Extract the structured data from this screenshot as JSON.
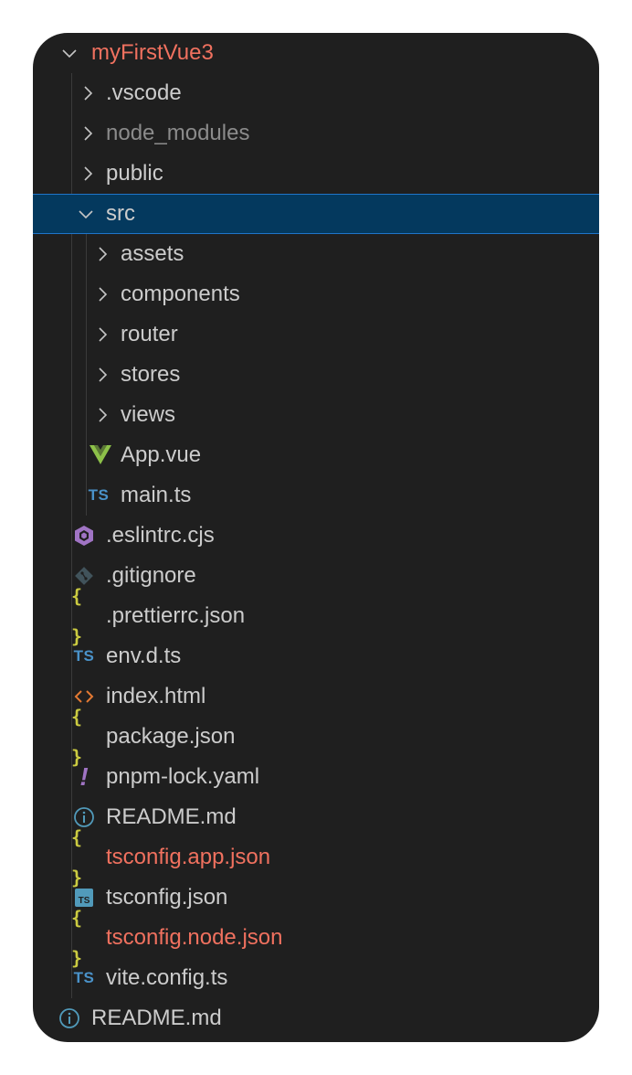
{
  "explorer": {
    "root": {
      "label": "myFirstVue3",
      "expanded": true
    },
    "items": [
      {
        "label": ".vscode",
        "kind": "folder",
        "expanded": false,
        "depth": 1
      },
      {
        "label": "node_modules",
        "kind": "folder",
        "expanded": false,
        "depth": 1,
        "ignored": true
      },
      {
        "label": "public",
        "kind": "folder",
        "expanded": false,
        "depth": 1
      },
      {
        "label": "src",
        "kind": "folder",
        "expanded": true,
        "depth": 1,
        "selected": true
      },
      {
        "label": "assets",
        "kind": "folder",
        "expanded": false,
        "depth": 2
      },
      {
        "label": "components",
        "kind": "folder",
        "expanded": false,
        "depth": 2
      },
      {
        "label": "router",
        "kind": "folder",
        "expanded": false,
        "depth": 2
      },
      {
        "label": "stores",
        "kind": "folder",
        "expanded": false,
        "depth": 2
      },
      {
        "label": "views",
        "kind": "folder",
        "expanded": false,
        "depth": 2
      },
      {
        "label": "App.vue",
        "kind": "file",
        "icon": "vue-icon",
        "depth": 2
      },
      {
        "label": "main.ts",
        "kind": "file",
        "icon": "typescript-icon",
        "depth": 2
      },
      {
        "label": ".eslintrc.cjs",
        "kind": "file",
        "icon": "eslint-icon",
        "depth": 1
      },
      {
        "label": ".gitignore",
        "kind": "file",
        "icon": "git-icon",
        "depth": 1
      },
      {
        "label": ".prettierrc.json",
        "kind": "file",
        "icon": "json-icon",
        "depth": 1
      },
      {
        "label": "env.d.ts",
        "kind": "file",
        "icon": "typescript-icon",
        "depth": 1
      },
      {
        "label": "index.html",
        "kind": "file",
        "icon": "html-icon",
        "depth": 1
      },
      {
        "label": "package.json",
        "kind": "file",
        "icon": "json-icon",
        "depth": 1
      },
      {
        "label": "pnpm-lock.yaml",
        "kind": "file",
        "icon": "yaml-icon",
        "depth": 1
      },
      {
        "label": "README.md",
        "kind": "file",
        "icon": "info-icon",
        "depth": 1
      },
      {
        "label": "tsconfig.app.json",
        "kind": "file",
        "icon": "json-icon",
        "depth": 1,
        "modified": true
      },
      {
        "label": "tsconfig.json",
        "kind": "file",
        "icon": "tsconfig-icon",
        "depth": 1
      },
      {
        "label": "tsconfig.node.json",
        "kind": "file",
        "icon": "json-icon",
        "depth": 1,
        "modified": true
      },
      {
        "label": "vite.config.ts",
        "kind": "file",
        "icon": "typescript-icon",
        "depth": 1
      },
      {
        "label": "README.md",
        "kind": "file",
        "icon": "info-icon",
        "depth": 0
      }
    ],
    "icon_text": {
      "ts": "TS",
      "brace": "{ }",
      "bang": "!"
    },
    "colors": {
      "background": "#1f1f1f",
      "text": "#cccccc",
      "modified": "#f0715f",
      "ignored": "#8b8b8b",
      "selection": "#04395e",
      "selection_border": "#1f75c9"
    }
  }
}
